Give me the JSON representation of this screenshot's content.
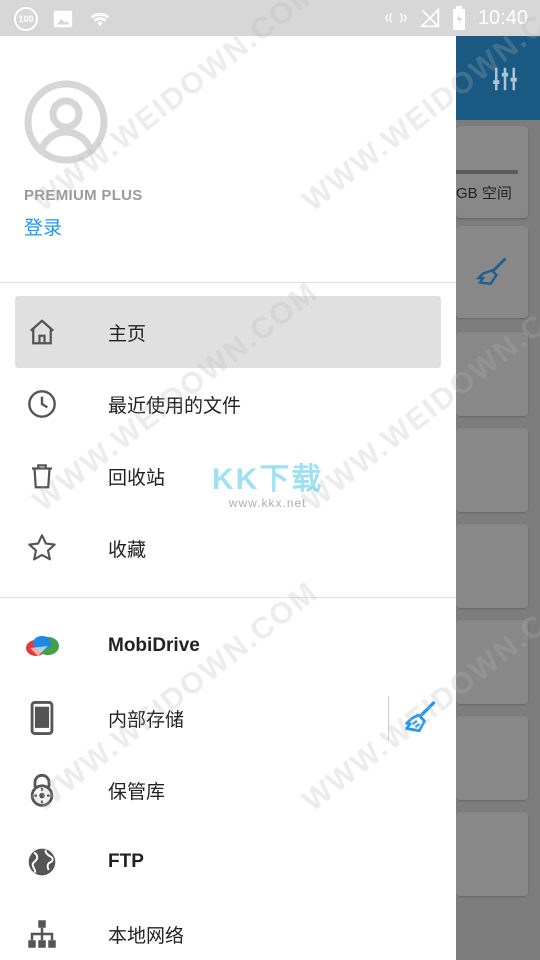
{
  "status_bar": {
    "battery_badge": "100",
    "time": "10:40"
  },
  "background_app": {
    "storage_text": "GB 空间",
    "toolbar_color": "#1a5a82"
  },
  "drawer": {
    "tier": "PREMIUM PLUS",
    "login_label": "登录",
    "primary_items": [
      {
        "label": "主页",
        "icon": "home-icon",
        "selected": true
      },
      {
        "label": "最近使用的文件",
        "icon": "clock-icon"
      },
      {
        "label": "回收站",
        "icon": "trash-icon"
      },
      {
        "label": "收藏",
        "icon": "star-icon"
      }
    ],
    "storage_items": [
      {
        "label": "MobiDrive",
        "icon": "mobidrive-logo-icon"
      },
      {
        "label": "内部存储",
        "icon": "phone-icon"
      },
      {
        "label": "保管库",
        "icon": "lock-icon"
      },
      {
        "label": "FTP",
        "icon": "globe-icon"
      },
      {
        "label": "本地网络",
        "icon": "network-icon"
      }
    ]
  },
  "watermark": {
    "text": "WWW.WEIDOWN.COM",
    "kkx_main": "KK下载",
    "kkx_sub": "www.kkx.net"
  },
  "colors": {
    "accent": "#2196f3",
    "selected_bg": "#e0e0e0",
    "status_bar": "#d7d7d7"
  }
}
